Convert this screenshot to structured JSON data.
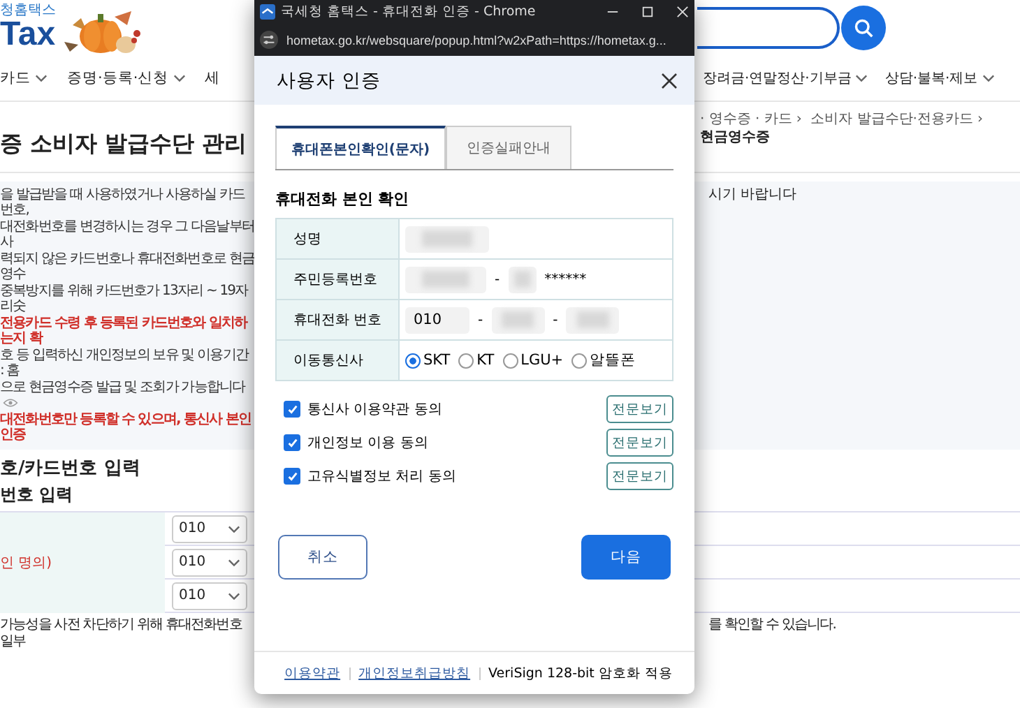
{
  "page": {
    "logo": {
      "subtitle": "청홈택스",
      "wordmark": "Tax"
    },
    "nav_left": [
      {
        "label": "카드",
        "dropdown": true
      },
      {
        "label": "증명·등록·신청",
        "dropdown": true
      },
      {
        "label": "세",
        "dropdown": false
      }
    ],
    "nav_right": [
      {
        "label": "장려금·연말정산·기부금",
        "dropdown": true
      },
      {
        "label": "상담·불복·제보",
        "dropdown": true
      }
    ],
    "breadcrumb": {
      "separator": "›",
      "items": [
        {
          "label": "· 영수증 · 카드",
          "current": false
        },
        {
          "label": "소비자 발급수단·전용카드",
          "current": false
        },
        {
          "label": "현금영수증",
          "current": true
        }
      ]
    },
    "title": "증 소비자 발급수단 관리",
    "notice_lines": [
      {
        "kind": "normal",
        "text": "을 발급받을 때 사용하였거나 사용하실 카드번호,"
      },
      {
        "kind": "normal",
        "text": "대전화번호를 변경하시는 경우 그 다음날부터 사"
      },
      {
        "kind": "normal",
        "text": "력되지 않은 카드번호나 휴대전화번호로 현금영수"
      },
      {
        "kind": "normal",
        "text": "중복방지를 위해 카드번호가 13자리 ~ 19자리숫"
      },
      {
        "kind": "alert",
        "text": "전용카드 수령 후 등록된 카드번호와 일치하는지 확"
      },
      {
        "kind": "normal",
        "text": "호 등 입력하신 개인정보의 보유 및 이용기간 : 홈"
      },
      {
        "kind": "eye",
        "text": "으로 현금영수증 발급 및 조회가 가능합니다"
      },
      {
        "kind": "alert",
        "text": "대전화번호만 등록할 수 있으며, 통신사 본인인증"
      }
    ],
    "notice_right": "시기 바랍니다",
    "section_heading": "호/카드번호 입력",
    "subsection_heading": "번호 입력",
    "phone_table": {
      "label": "인 명의)",
      "selects": [
        "010",
        "010",
        "010"
      ]
    },
    "bottom_note_left": "가능성을 사전 차단하기 위해 휴대전화번호 일부",
    "bottom_note_right": "를 확인할 수 있습니다."
  },
  "popup": {
    "window_title": "국세청 홈택스 - 휴대전화 인증 - Chrome",
    "url": "hometax.go.kr/websquare/popup.html?w2xPath=https://hometax.g...",
    "header": "사용자 인증",
    "tabs": [
      {
        "label": "휴대폰본인확인(문자)",
        "selected": true
      },
      {
        "label": "인증실패안내",
        "selected": false
      }
    ],
    "section_title": "휴대전화 본인 확인",
    "rows": [
      {
        "kind": "masked",
        "label": "성명"
      },
      {
        "kind": "rrn",
        "label": "주민등록번호",
        "separator": "-",
        "suffix": "******"
      },
      {
        "kind": "phone",
        "label": "휴대전화 번호",
        "prefix": "010",
        "separator": "-"
      },
      {
        "kind": "carrier",
        "label": "이동통신사",
        "options": [
          {
            "label": "SKT",
            "selected": true
          },
          {
            "label": "KT",
            "selected": false
          },
          {
            "label": "LGU+",
            "selected": false
          },
          {
            "label": "알뜰폰",
            "selected": false
          }
        ]
      }
    ],
    "agreements": [
      {
        "label": "통신사 이용약관 동의",
        "checked": true,
        "button": "전문보기"
      },
      {
        "label": "개인정보 이용 동의",
        "checked": true,
        "button": "전문보기"
      },
      {
        "label": "고유식별정보 처리 동의",
        "checked": true,
        "button": "전문보기"
      }
    ],
    "cancel": "취소",
    "next": "다음",
    "footer_links": [
      "이용약관",
      "개인정보취급방침"
    ],
    "footer_note": "VeriSign 128-bit 암호화 적용"
  }
}
